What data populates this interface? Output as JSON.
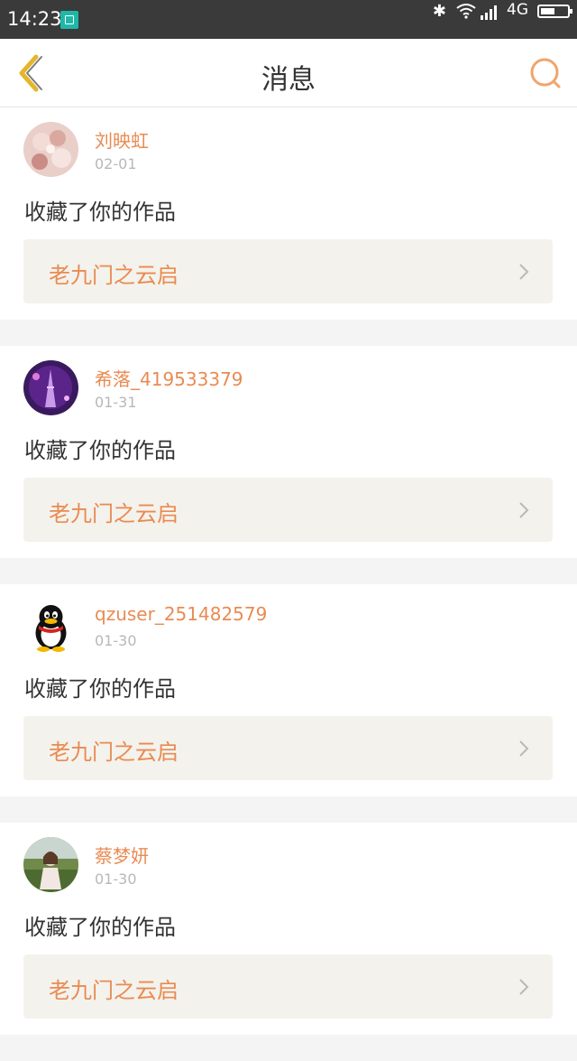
{
  "status_bar": {
    "time": "14:23",
    "network": "4G",
    "battery_level": 0.55,
    "icons": [
      "screenshot-icon",
      "bluetooth-icon",
      "wifi-icon",
      "signal-icon",
      "battery-icon"
    ]
  },
  "header": {
    "title": "消息",
    "back_icon": "chevron-left-icon",
    "search_icon": "search-icon"
  },
  "colors": {
    "accent": "#e98b52",
    "back_icon": "#e5b52d",
    "work_box_bg": "#f4f2ec"
  },
  "messages": [
    {
      "username": "刘映虹",
      "date": "02-01",
      "action": "收藏了你的作品",
      "work_title": "老九门之云启"
    },
    {
      "username": "希落_419533379",
      "date": "01-31",
      "action": "收藏了你的作品",
      "work_title": "老九门之云启"
    },
    {
      "username": "qzuser_251482579",
      "date": "01-30",
      "action": "收藏了你的作品",
      "work_title": "老九门之云启"
    },
    {
      "username": "蔡梦妍",
      "date": "01-30",
      "action": "收藏了你的作品",
      "work_title": "老九门之云启"
    }
  ]
}
